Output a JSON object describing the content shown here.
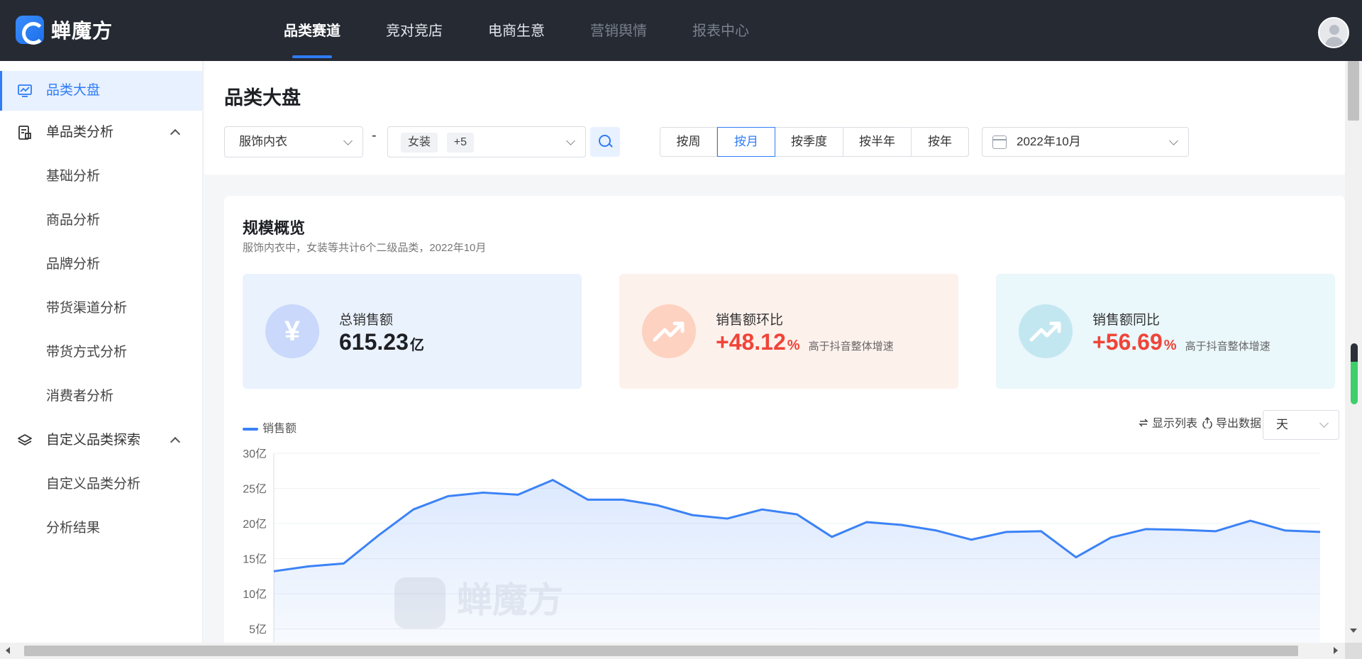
{
  "brand": {
    "name": "蝉魔方"
  },
  "nav": {
    "items": [
      {
        "label": "品类赛道",
        "state": "active"
      },
      {
        "label": "竞对竞店",
        "state": "normal"
      },
      {
        "label": "电商生意",
        "state": "normal"
      },
      {
        "label": "营销舆情",
        "state": "dim"
      },
      {
        "label": "报表中心",
        "state": "dim"
      }
    ]
  },
  "sidebar": {
    "items": [
      {
        "label": "品类大盘",
        "icon": "chart-monitor-icon",
        "active": true
      },
      {
        "label": "单品类分析",
        "icon": "document-chart-icon",
        "expanded": true
      },
      {
        "label": "基础分析"
      },
      {
        "label": "商品分析"
      },
      {
        "label": "品牌分析"
      },
      {
        "label": "带货渠道分析"
      },
      {
        "label": "带货方式分析"
      },
      {
        "label": "消费者分析"
      },
      {
        "label": "自定义品类探索",
        "icon": "layers-icon",
        "expanded": true
      },
      {
        "label": "自定义品类分析"
      },
      {
        "label": "分析结果"
      }
    ]
  },
  "page": {
    "title": "品类大盘"
  },
  "filters": {
    "category": "服饰内衣",
    "separator": "-",
    "subcategory_tag": "女装",
    "subcategory_more": "+5",
    "periods": [
      "按周",
      "按月",
      "按季度",
      "按半年",
      "按年"
    ],
    "active_period": "按月",
    "date": "2022年10月"
  },
  "overview": {
    "title": "规模概览",
    "subtitle": "服饰内衣中，女装等共计6个二级品类，2022年10月",
    "stats": [
      {
        "label": "总销售额",
        "value": "615.23",
        "unit": "亿",
        "note": "",
        "icon": "yen-icon",
        "bg": "#eaf2fd",
        "circle": "#c9d8fb",
        "value_color": "#1d1f24"
      },
      {
        "label": "销售额环比",
        "value": "+48.12",
        "unit": "%",
        "note": "高于抖音整体增速",
        "icon": "trend-up-icon",
        "bg": "#fdf1ec",
        "circle": "#fdd2c0",
        "value_color": "#f04438"
      },
      {
        "label": "销售额同比",
        "value": "+56.69",
        "unit": "%",
        "note": "高于抖音整体增速",
        "icon": "trend-up-icon",
        "bg": "#eaf7fb",
        "circle": "#c3e7f1",
        "value_color": "#f04438"
      }
    ]
  },
  "chart_tools": {
    "legend": "销售额",
    "show_table": "显示列表",
    "export": "导出数据",
    "granularity": "天"
  },
  "chart_data": {
    "type": "area",
    "series": [
      {
        "name": "销售额",
        "values": [
          13.2,
          13.9,
          14.3,
          18.3,
          22.0,
          23.9,
          24.4,
          24.1,
          26.2,
          23.4,
          23.4,
          22.6,
          21.2,
          20.7,
          22.0,
          21.3,
          18.1,
          20.2,
          19.8,
          19.0,
          17.7,
          18.8,
          18.9,
          15.2,
          18.0,
          19.2,
          19.1,
          18.9,
          20.4,
          19.0,
          18.8
        ]
      }
    ],
    "ylim": [
      0,
      30
    ],
    "yticks": [
      "5亿",
      "10亿",
      "15亿",
      "20亿",
      "25亿",
      "30亿"
    ],
    "color": "#3b82f6",
    "grid": true
  }
}
